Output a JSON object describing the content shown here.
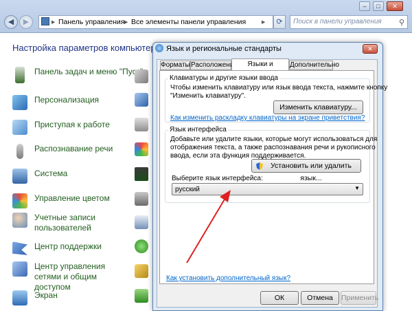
{
  "window_controls": {
    "minimize": "–",
    "maximize": "□",
    "close": "✕"
  },
  "address": {
    "seg1": "Панель управления",
    "seg2": "Все элементы панели управления",
    "sep": "▸",
    "refresh": "⟳",
    "search_placeholder": "Поиск в панели управления",
    "search_icon": "search-icon"
  },
  "nav": {
    "back": "◀",
    "forward": "▶"
  },
  "cpl": {
    "title": "Настройка параметров компьютера",
    "items": [
      {
        "label": "Панель задач и меню \"Пуск\"",
        "icon": "taskbar-icon",
        "color": "#3d6f2f"
      },
      {
        "label": "Персонализация",
        "icon": "personalization-icon",
        "color": "#3b7dc4"
      },
      {
        "label": "Приступая к работе",
        "icon": "getting-started-icon",
        "color": "#5e9ad6"
      },
      {
        "label": "Распознавание речи",
        "icon": "microphone-icon",
        "color": "#8a8a8a"
      },
      {
        "label": "Система",
        "icon": "system-icon",
        "color": "#4a7ab3"
      },
      {
        "label": "Управление цветом",
        "icon": "color-management-icon",
        "color": "#3f9fd3"
      },
      {
        "label": "Учетные записи пользователей",
        "icon": "users-icon",
        "color": "#6b8fb8"
      },
      {
        "label": "Центр поддержки",
        "icon": "flag-icon",
        "color": "#2c5fb0"
      },
      {
        "label": "Центр управления сетями и общим доступом",
        "icon": "network-icon",
        "color": "#4a78c2"
      },
      {
        "label": "Экран",
        "icon": "display-icon",
        "color": "#3b83c9"
      }
    ]
  },
  "dialog": {
    "title": "Язык и региональные стандарты",
    "close": "✕",
    "tabs": [
      "Форматы",
      "Расположение",
      "Языки и клавиатуры",
      "Дополнительно"
    ],
    "active_tab": "Языки и клавиатуры",
    "group1": {
      "title": "Клавиатуры и другие языки ввода",
      "text_line1": "Чтобы изменить клавиатуру или язык ввода текста, нажмите кнопку",
      "text_line2": "\"Изменить клавиатуру\".",
      "button": "Изменить клавиатуру...",
      "link": "Как изменить раскладку клавиатуры на экране приветствия?"
    },
    "group2": {
      "title": "Язык интерфейса",
      "text_line1": "Добавьте или удалите языки, которые могут использоваться для",
      "text_line2": "отображения текста, а также распознавания речи и рукописного",
      "text_line3": "ввода, если эта функция поддерживается.",
      "button": "Установить или удалить язык...",
      "select_label": "Выберите язык интерфейса:",
      "select_value": "русский"
    },
    "bottom_link": "Как установить дополнительный язык?",
    "ok": "ОК",
    "cancel": "Отмена",
    "apply": "Применить"
  },
  "annotation": {
    "color": "#e02020"
  }
}
